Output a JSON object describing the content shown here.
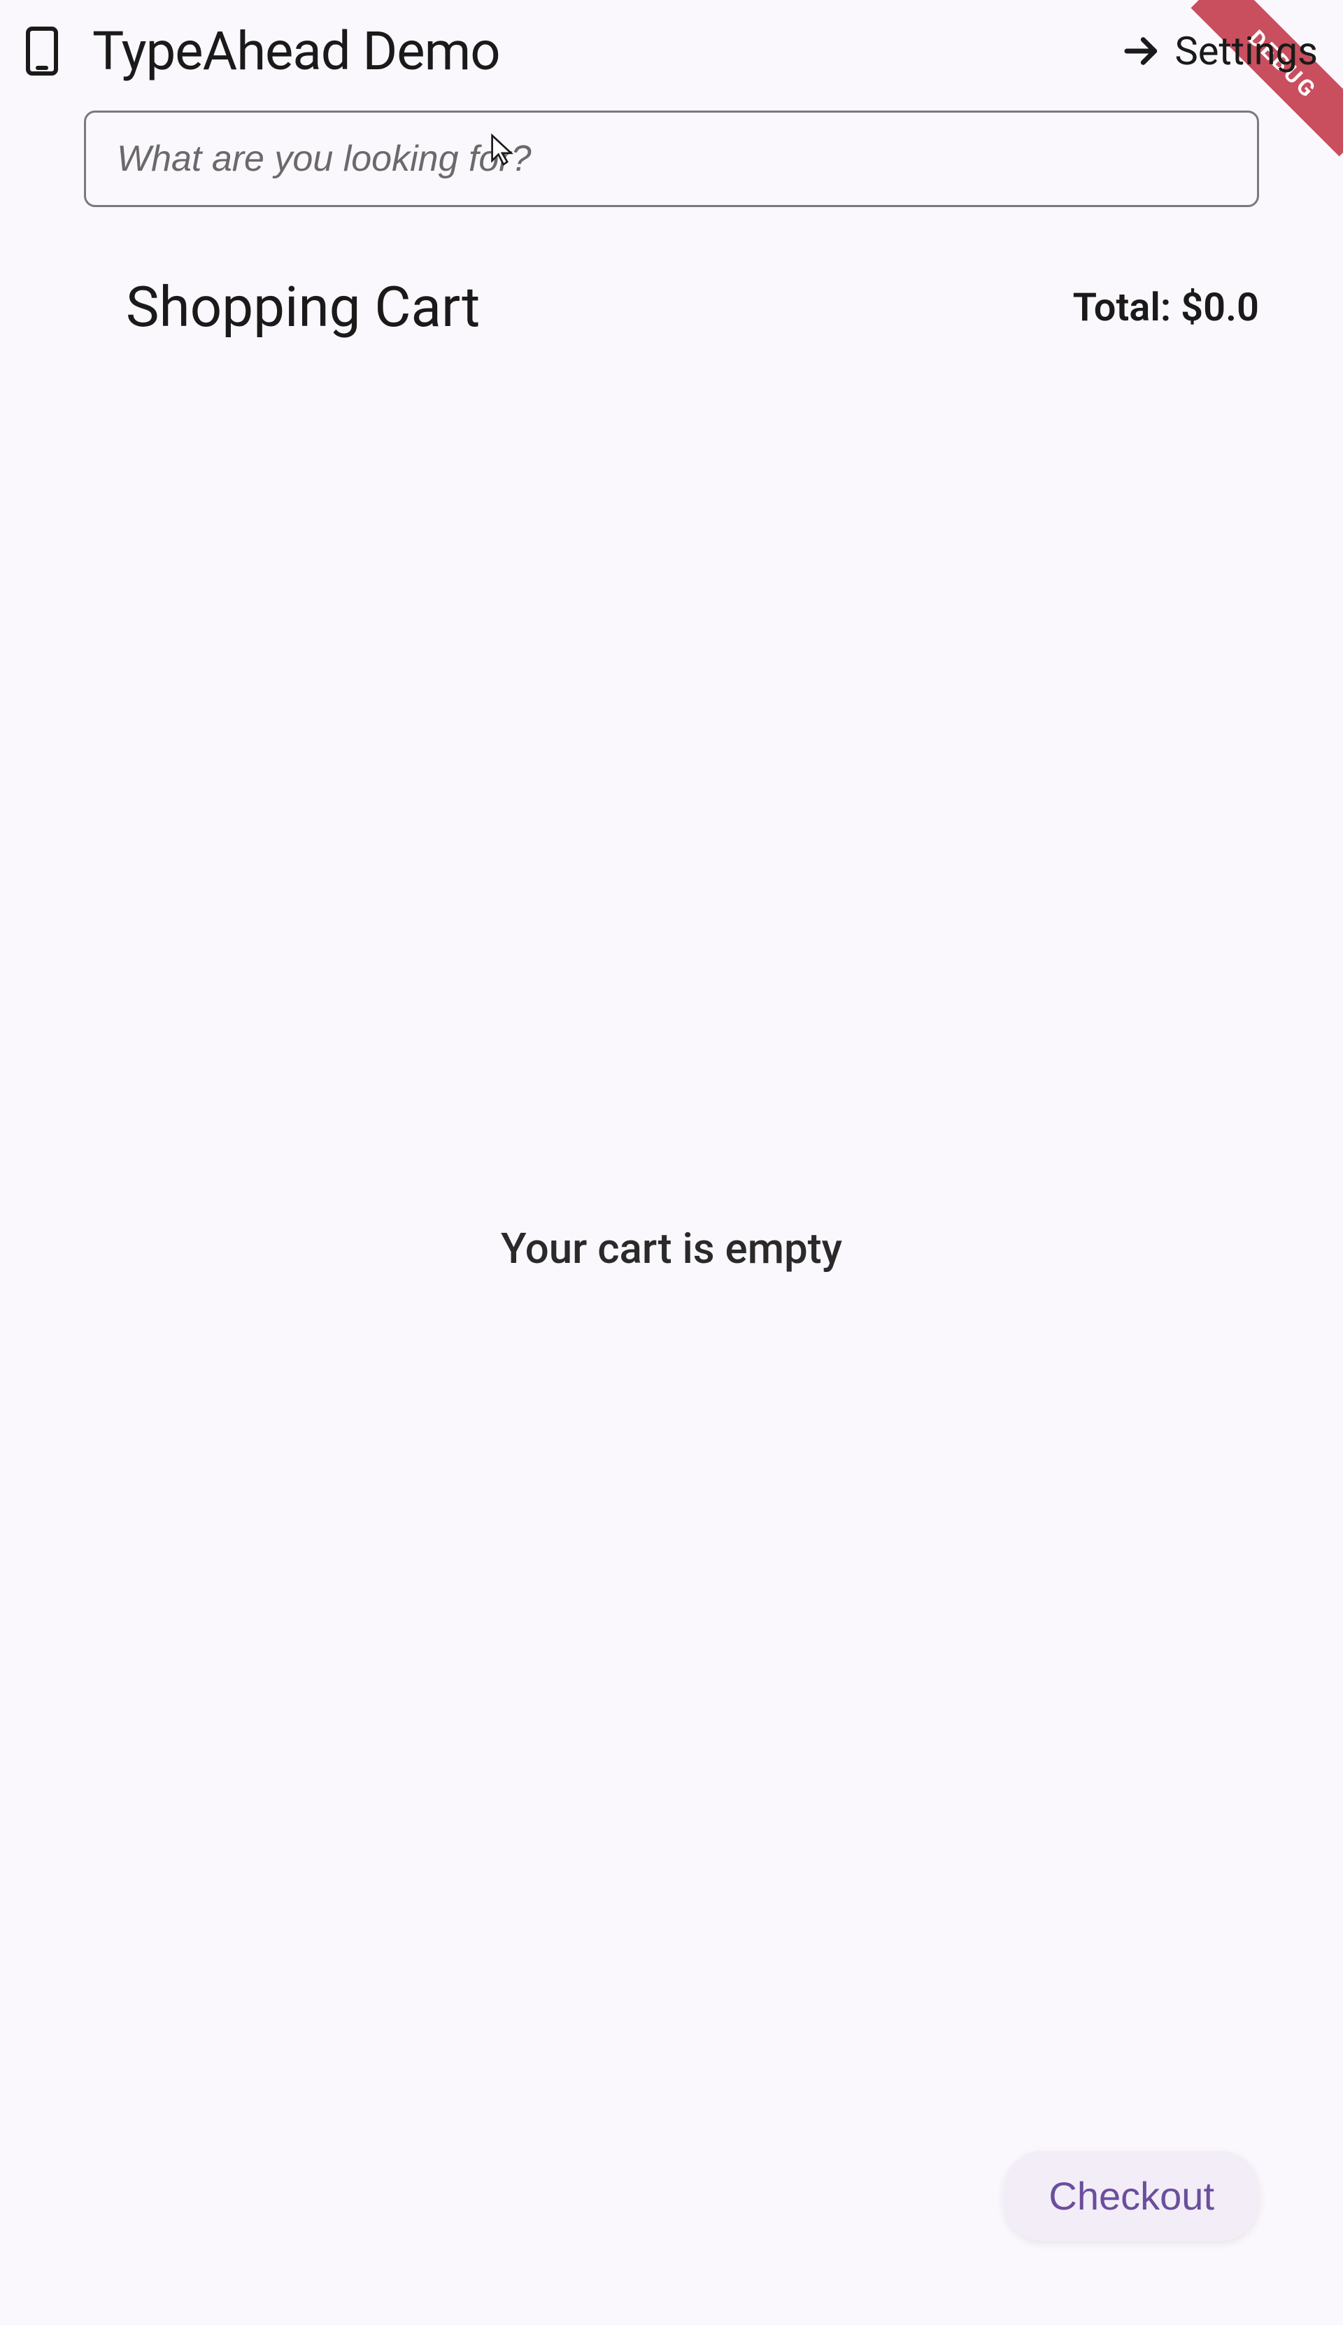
{
  "header": {
    "app_title": "TypeAhead Demo",
    "settings_label": "Settings",
    "debug_label": "DEBUG"
  },
  "search": {
    "placeholder": "What are you looking for?",
    "value": ""
  },
  "cart": {
    "title": "Shopping Cart",
    "total_label": "Total: $0.0",
    "empty_message": "Your cart is empty",
    "checkout_label": "Checkout"
  }
}
